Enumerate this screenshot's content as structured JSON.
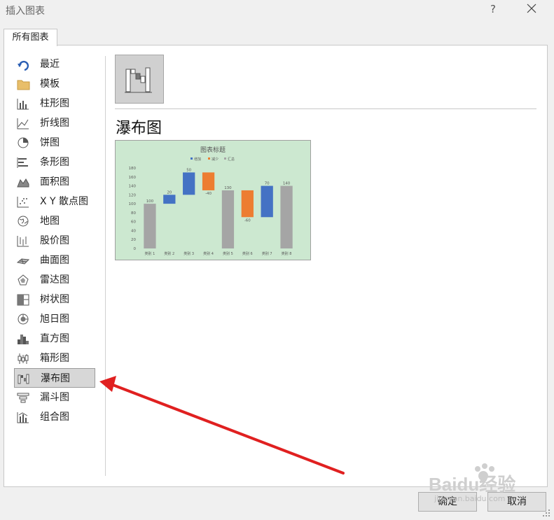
{
  "window": {
    "title": "插入图表",
    "help": "?"
  },
  "tab": {
    "label": "所有图表"
  },
  "sidebar": {
    "items": [
      {
        "label": "最近",
        "icon": "recent-icon"
      },
      {
        "label": "模板",
        "icon": "folder-icon"
      },
      {
        "label": "柱形图",
        "icon": "column-chart-icon"
      },
      {
        "label": "折线图",
        "icon": "line-chart-icon"
      },
      {
        "label": "饼图",
        "icon": "pie-chart-icon"
      },
      {
        "label": "条形图",
        "icon": "bar-chart-icon"
      },
      {
        "label": "面积图",
        "icon": "area-chart-icon"
      },
      {
        "label": "X Y 散点图",
        "icon": "scatter-chart-icon"
      },
      {
        "label": "地图",
        "icon": "map-chart-icon"
      },
      {
        "label": "股价图",
        "icon": "stock-chart-icon"
      },
      {
        "label": "曲面图",
        "icon": "surface-chart-icon"
      },
      {
        "label": "雷达图",
        "icon": "radar-chart-icon"
      },
      {
        "label": "树状图",
        "icon": "treemap-chart-icon"
      },
      {
        "label": "旭日图",
        "icon": "sunburst-chart-icon"
      },
      {
        "label": "直方图",
        "icon": "histogram-chart-icon"
      },
      {
        "label": "箱形图",
        "icon": "box-whisker-chart-icon"
      },
      {
        "label": "瀑布图",
        "icon": "waterfall-chart-icon",
        "selected": true
      },
      {
        "label": "漏斗图",
        "icon": "funnel-chart-icon"
      },
      {
        "label": "组合图",
        "icon": "combo-chart-icon"
      }
    ]
  },
  "main": {
    "chart_type_title": "瀑布图"
  },
  "buttons": {
    "ok": "确定",
    "cancel": "取消"
  },
  "watermark": {
    "text": "Baidu经验",
    "subtext": "jingyan.baidu.com"
  },
  "colors": {
    "increase": "#4472c4",
    "decrease": "#ed7d31",
    "total": "#a5a5a5",
    "preview_bg": "#cce8d0",
    "annotation_arrow": "#e02020"
  },
  "chart_data": {
    "type": "waterfall",
    "title": "图表标题",
    "legend": [
      "增加",
      "减少",
      "汇总"
    ],
    "legend_position": "top",
    "categories": [
      "类别 1",
      "类别 2",
      "类别 3",
      "类别 4",
      "类别 5",
      "类别 6",
      "类别 7",
      "类别 8"
    ],
    "values": [
      100,
      20,
      50,
      -40,
      130,
      -60,
      70,
      140
    ],
    "kinds": [
      "total",
      "increase",
      "increase",
      "decrease",
      "total",
      "decrease",
      "increase",
      "total"
    ],
    "bar_ranges": [
      [
        0,
        100
      ],
      [
        100,
        120
      ],
      [
        120,
        170
      ],
      [
        130,
        170
      ],
      [
        0,
        130
      ],
      [
        70,
        130
      ],
      [
        70,
        140
      ],
      [
        0,
        140
      ]
    ],
    "data_labels": [
      "100",
      "20",
      "50",
      "-40",
      "130",
      "-60",
      "70",
      "140"
    ],
    "ylim": [
      0,
      180
    ],
    "yticks": [
      0,
      20,
      40,
      60,
      80,
      100,
      120,
      140,
      160,
      180
    ],
    "grid": false
  }
}
